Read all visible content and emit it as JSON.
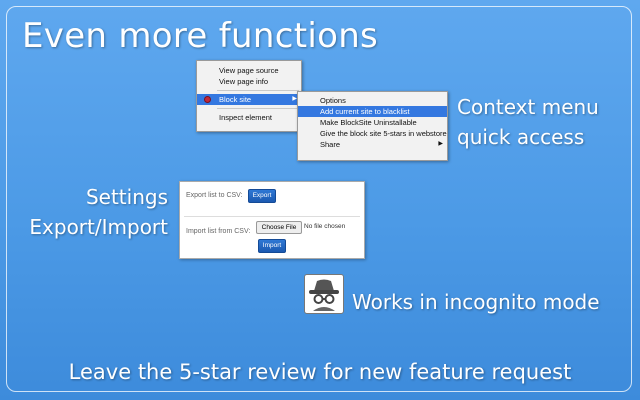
{
  "title": "Even more functions",
  "context_label": [
    "Context menu",
    "quick access"
  ],
  "settings_label": [
    "Settings",
    "Export/Import"
  ],
  "incognito_label": "Works in incognito mode",
  "footer": "Leave the 5-star review for new feature request",
  "menu": {
    "main": {
      "view_source": "View page source",
      "view_info": "View page info",
      "block_site": "Block site",
      "inspect": "Inspect element"
    },
    "sub": {
      "options": "Options",
      "add_current": "Add current site to blacklist",
      "uninstallable": "Make BlockSite Uninstallable",
      "give_stars": "Give the block site 5-stars in webstore",
      "share": "Share"
    }
  },
  "settings_panel": {
    "export_label": "Export list to CSV:",
    "export_button": "Export",
    "import_label": "Import list from CSV:",
    "choose_file": "Choose File",
    "no_file": "No file chosen",
    "import_button": "Import"
  },
  "icons": {
    "block": "block-site-icon",
    "incognito": "incognito-icon",
    "submenu": "submenu-arrow-icon"
  }
}
